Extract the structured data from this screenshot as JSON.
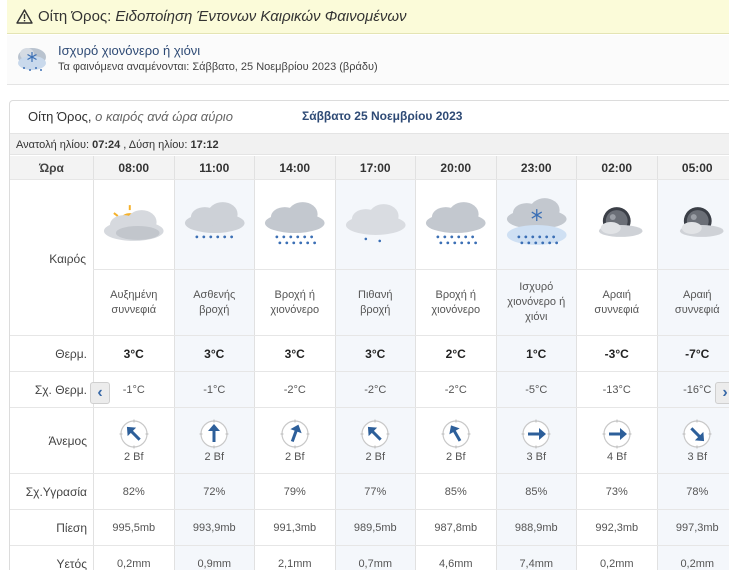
{
  "alert": {
    "place": "Οίτη Όρος:",
    "text": "Ειδοποίηση Έντονων Καιρικών Φαινομένων",
    "title": "Ισχυρό χιονόνερο ή χιόνι",
    "expected_label": "Τα φαινόμενα αναμένονται:",
    "expected_value": "Σάββατο, 25 Νοεμβρίου 2023 (βράδυ)"
  },
  "forecast": {
    "city": "Οίτη Όρος,",
    "subtitle": "ο καιρός ανά ώρα αύριο",
    "date": "Σάββατο 25 Νοεμβρίου 2023",
    "sunrise_label": "Ανατολή ηλίου:",
    "sunrise": "07:24",
    "sunset_label": ", Δύση ηλίου:",
    "sunset": "17:12"
  },
  "labels": {
    "time": "Ώρα",
    "weather": "Καιρός",
    "temp": "Θερμ.",
    "feels": "Σχ. Θερμ.",
    "wind": "Άνεμος",
    "humidity": "Σχ.Υγρασία",
    "pressure": "Πίεση",
    "rain": "Υετός"
  },
  "hours": [
    {
      "time": "08:00",
      "icon": "partly-sunny-icon",
      "desc": "Αυξημένη συννεφιά",
      "temp": "3°C",
      "feels": "-1°C",
      "wind_dir": "arrow-northwest",
      "wind_angle": 315,
      "wind": "2 Bf",
      "humidity": "82%",
      "pressure": "995,5mb",
      "rain": "0,2mm"
    },
    {
      "time": "11:00",
      "icon": "light-rain-icon",
      "desc": "Ασθενής βροχή",
      "temp": "3°C",
      "feels": "-1°C",
      "wind_dir": "arrow-north",
      "wind_angle": 0,
      "wind": "2 Bf",
      "humidity": "72%",
      "pressure": "993,9mb",
      "rain": "0,9mm"
    },
    {
      "time": "14:00",
      "icon": "rain-sleet-icon",
      "desc": "Βροχή ή χιονόνερο",
      "temp": "3°C",
      "feels": "-2°C",
      "wind_dir": "arrow-northeast",
      "wind_angle": 20,
      "wind": "2 Bf",
      "humidity": "79%",
      "pressure": "991,3mb",
      "rain": "2,1mm"
    },
    {
      "time": "17:00",
      "icon": "possible-rain-icon",
      "desc": "Πιθανή βροχή",
      "temp": "3°C",
      "feels": "-2°C",
      "wind_dir": "arrow-northwest",
      "wind_angle": 315,
      "wind": "2 Bf",
      "humidity": "77%",
      "pressure": "989,5mb",
      "rain": "0,7mm"
    },
    {
      "time": "20:00",
      "icon": "rain-sleet-icon",
      "desc": "Βροχή ή χιονόνερο",
      "temp": "2°C",
      "feels": "-2°C",
      "wind_dir": "arrow-northwest",
      "wind_angle": 330,
      "wind": "2 Bf",
      "humidity": "85%",
      "pressure": "987,8mb",
      "rain": "4,6mm"
    },
    {
      "time": "23:00",
      "icon": "heavy-snow-icon",
      "desc": "Ισχυρό χιονόνερο ή χιόνι",
      "temp": "1°C",
      "feels": "-5°C",
      "wind_dir": "arrow-east",
      "wind_angle": 90,
      "wind": "3 Bf",
      "humidity": "85%",
      "pressure": "988,9mb",
      "rain": "7,4mm"
    },
    {
      "time": "02:00",
      "icon": "night-cloudy-icon",
      "desc": "Αραιή συννεφιά",
      "temp": "-3°C",
      "feels": "-13°C",
      "wind_dir": "arrow-east",
      "wind_angle": 90,
      "wind": "4 Bf",
      "humidity": "73%",
      "pressure": "992,3mb",
      "rain": "0,2mm"
    },
    {
      "time": "05:00",
      "icon": "night-cloudy-icon",
      "desc": "Αραιή συννεφιά",
      "temp": "-7°C",
      "feels": "-16°C",
      "wind_dir": "arrow-southeast",
      "wind_angle": 135,
      "wind": "3 Bf",
      "humidity": "78%",
      "pressure": "997,3mb",
      "rain": "0,2mm"
    }
  ],
  "colors": {
    "accent": "#2e4a75",
    "arrow": "#2d5f9a",
    "banner": "#fbfbd9"
  }
}
